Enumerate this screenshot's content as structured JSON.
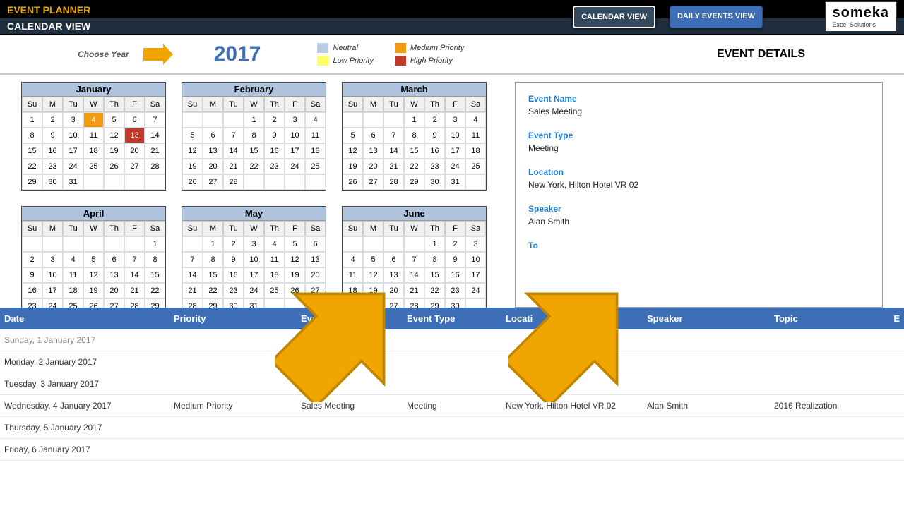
{
  "header": {
    "app_title": "EVENT PLANNER",
    "sub_title": "CALENDAR VIEW",
    "btn_calendar": "CALENDAR VIEW",
    "btn_daily": "DAILY EVENTS VIEW",
    "logo_main": "someka",
    "logo_sub": "Excel Solutions"
  },
  "toolbar": {
    "choose_year": "Choose Year",
    "year": "2017",
    "legend": {
      "neutral": "Neutral",
      "low": "Low Priority",
      "medium": "Medium Priority",
      "high": "High Priority"
    },
    "details_title": "EVENT DETAILS"
  },
  "months": [
    "January",
    "February",
    "March",
    "April",
    "May",
    "June"
  ],
  "dow": [
    "Su",
    "M",
    "Tu",
    "W",
    "Th",
    "F",
    "Sa"
  ],
  "month_data": [
    {
      "start": 0,
      "days": 31,
      "highlights": {
        "4": "medium",
        "13": "high"
      }
    },
    {
      "start": 3,
      "days": 28,
      "highlights": {}
    },
    {
      "start": 3,
      "days": 31,
      "highlights": {}
    },
    {
      "start": 6,
      "days": 30,
      "highlights": {}
    },
    {
      "start": 1,
      "days": 31,
      "highlights": {}
    },
    {
      "start": 4,
      "days": 30,
      "highlights": {}
    }
  ],
  "details": {
    "event_name_label": "Event Name",
    "event_name": "Sales Meeting",
    "event_type_label": "Event Type",
    "event_type": "Meeting",
    "location_label": "Location",
    "location": "New York, Hilton Hotel VR 02",
    "speaker_label": "Speaker",
    "speaker": "Alan Smith",
    "topic_label": "To"
  },
  "columns": {
    "date": "Date",
    "priority": "Priority",
    "event_name": "Event Nam",
    "event_type": "Event Type",
    "location": "Locati",
    "speaker": "Speaker",
    "topic": "Topic",
    "extra": "E"
  },
  "rows": [
    {
      "date": "Sunday, 1 January 2017",
      "priority": "",
      "event_name": "",
      "event_type": "",
      "location": "",
      "speaker": "",
      "topic": "",
      "cls": "sunday"
    },
    {
      "date": "Monday, 2 January 2017",
      "priority": "",
      "event_name": "",
      "event_type": "",
      "location": "",
      "speaker": "",
      "topic": ""
    },
    {
      "date": "Tuesday, 3 January 2017",
      "priority": "",
      "event_name": "",
      "event_type": "",
      "location": "",
      "speaker": "",
      "topic": ""
    },
    {
      "date": "Wednesday, 4 January 2017",
      "priority": "Medium Priority",
      "event_name": "Sales Meeting",
      "event_type": "Meeting",
      "location": "New York, Hilton Hotel VR 02",
      "speaker": "Alan Smith",
      "topic": "2016 Realization"
    },
    {
      "date": "Thursday, 5 January 2017",
      "priority": "",
      "event_name": "",
      "event_type": "",
      "location": "",
      "speaker": "",
      "topic": ""
    },
    {
      "date": "Friday, 6 January 2017",
      "priority": "",
      "event_name": "",
      "event_type": "",
      "location": "",
      "speaker": "",
      "topic": ""
    }
  ]
}
